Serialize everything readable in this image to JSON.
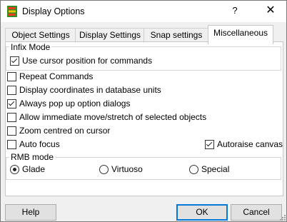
{
  "window": {
    "title": "Display Options",
    "help_glyph": "?",
    "close_glyph": "✕"
  },
  "tabs": [
    {
      "label": "Object Settings",
      "active": false
    },
    {
      "label": "Display Settings",
      "active": false
    },
    {
      "label": "Snap settings",
      "active": false
    },
    {
      "label": "Miscellaneous",
      "active": true
    }
  ],
  "infix_mode": {
    "group_label": "Infix Mode",
    "use_cursor": {
      "label": "Use cursor position for commands",
      "checked": true
    }
  },
  "options": {
    "repeat_commands": {
      "label": "Repeat Commands",
      "checked": false
    },
    "display_coords": {
      "label": "Display coordinates in database units",
      "checked": false
    },
    "always_popup": {
      "label": "Always pop up option dialogs",
      "checked": true
    },
    "allow_immediate": {
      "label": "Allow immediate move/stretch of selected objects",
      "checked": false
    },
    "zoom_centred": {
      "label": "Zoom centred on cursor",
      "checked": false
    },
    "auto_focus": {
      "label": "Auto focus",
      "checked": false
    },
    "autoraise": {
      "label": "Autoraise canvas",
      "checked": true
    }
  },
  "rmb_mode": {
    "group_label": "RMB mode",
    "choices": [
      {
        "label": "Glade",
        "selected": true
      },
      {
        "label": "Virtuoso",
        "selected": false
      },
      {
        "label": "Special",
        "selected": false
      }
    ]
  },
  "buttons": {
    "help": "Help",
    "ok": "OK",
    "cancel": "Cancel"
  },
  "colors": {
    "accent": "#0078d7",
    "panel_bg": "#ffffff",
    "dialog_bg": "#f0f0f0"
  }
}
